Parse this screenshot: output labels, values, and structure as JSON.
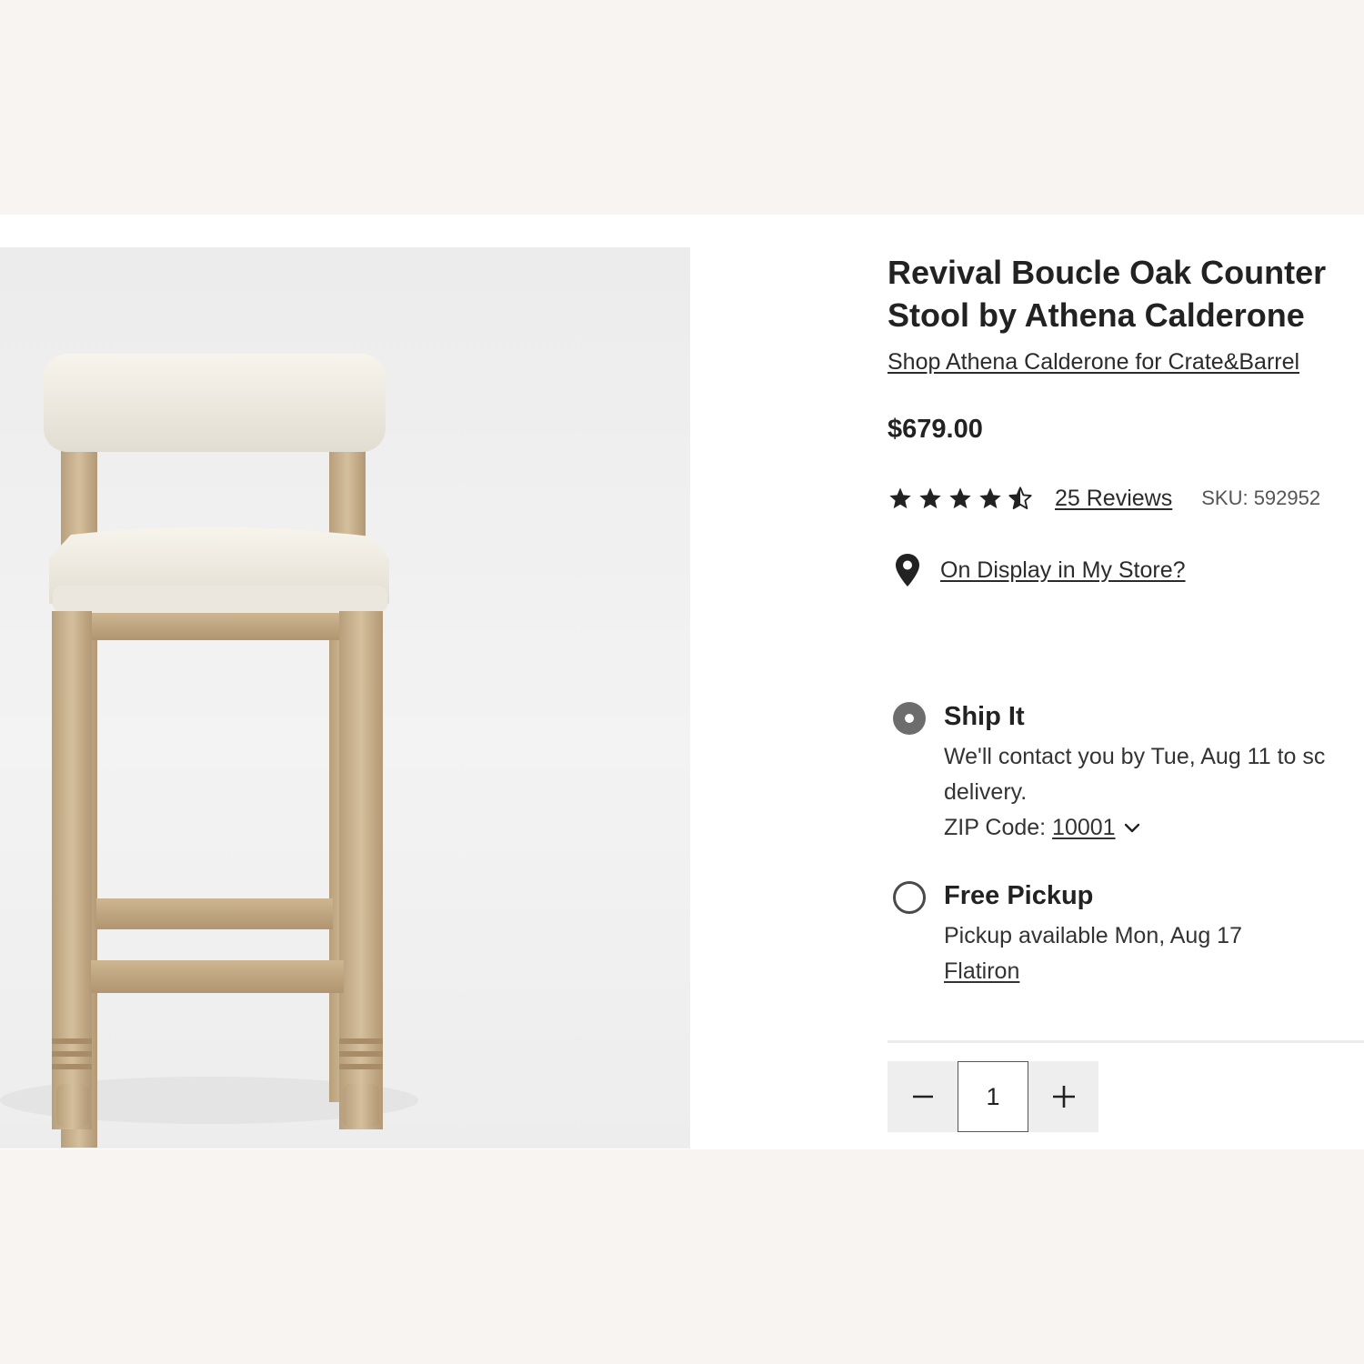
{
  "product": {
    "title": "Revival Boucle Oak Counter Stool by Athena Calderone",
    "designer_link": "Shop Athena Calderone for Crate&Barrel",
    "price": "$679.00",
    "rating": {
      "stars": 4.5,
      "max": 5,
      "reviews_label": "25 Reviews"
    },
    "sku": "SKU: 592952",
    "image_alt": "Revival Boucle Oak Counter Stool"
  },
  "store": {
    "display_link": "On Display in My Store?",
    "icon": "location-pin-icon"
  },
  "fulfillment": {
    "ship": {
      "title": "Ship It",
      "selected": true,
      "line1": "We'll contact you by Tue, Aug 11 to sc",
      "line2": "delivery.",
      "zip_label": "ZIP Code: ",
      "zip_value": "10001"
    },
    "pickup": {
      "title": "Free Pickup",
      "selected": false,
      "availability": "Pickup available Mon, Aug 17",
      "store_name": "Flatiron"
    }
  },
  "quantity": {
    "value": "1",
    "decrease_icon": "minus-icon",
    "increase_icon": "plus-icon"
  },
  "colors": {
    "text": "#222222",
    "star": "#222222",
    "radio_selected": "#6d6d6d",
    "qty_button_bg": "#eeeeee",
    "page_bg": "#f7f4f1"
  }
}
